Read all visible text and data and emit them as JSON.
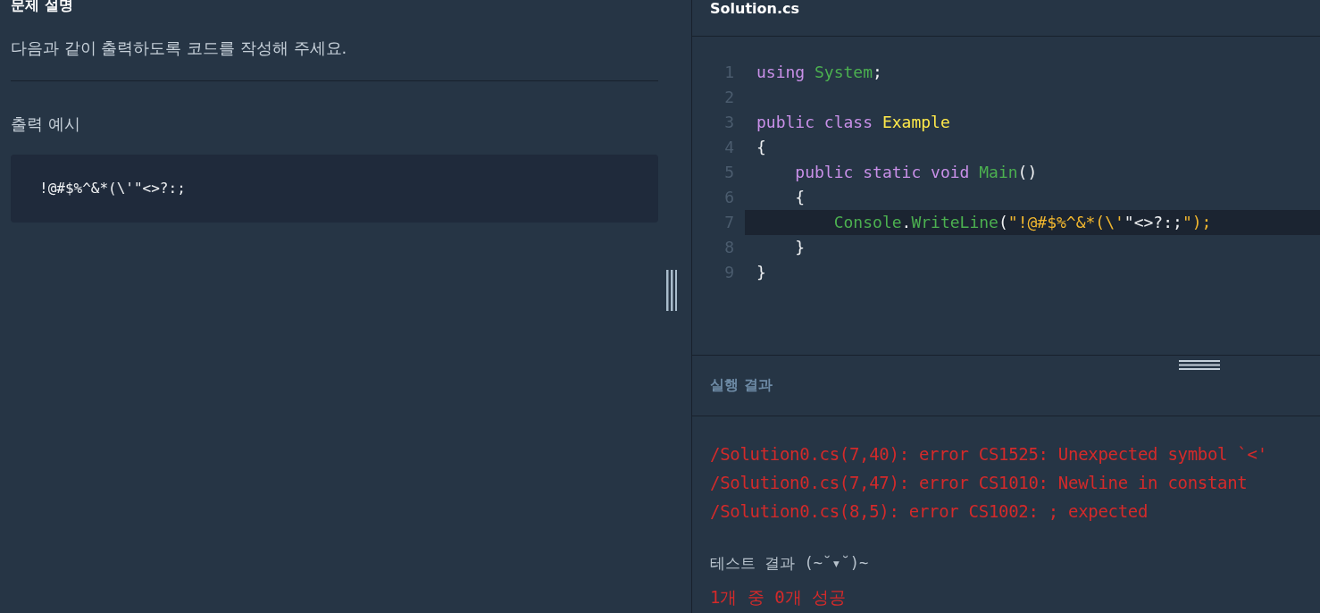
{
  "problem": {
    "title": "문제 설명",
    "description": "다음과 같이 출력하도록 코드를 작성해 주세요.",
    "example_title": "출력 예시",
    "example_output": "!@#$%^&*(\\'\"<>?:;"
  },
  "editor": {
    "filename": "Solution.cs",
    "lines": [
      {
        "number": "1",
        "highlighted": false,
        "tokens": [
          {
            "kind": "keyword",
            "text": "using"
          },
          {
            "kind": "type",
            "text": " System"
          },
          {
            "kind": "punct",
            "text": ";"
          }
        ]
      },
      {
        "number": "2",
        "highlighted": false
      },
      {
        "number": "3",
        "highlighted": false,
        "tokens": [
          {
            "kind": "keyword",
            "text": "public class"
          },
          {
            "kind": "class",
            "text": " Example"
          }
        ]
      },
      {
        "number": "4",
        "highlighted": false,
        "tokens": [
          {
            "kind": "punct",
            "text": "{"
          }
        ]
      },
      {
        "number": "5",
        "highlighted": false,
        "tokens": [
          {
            "kind": "keyword",
            "text": "    public static void"
          },
          {
            "kind": "type",
            "text": " Main"
          },
          {
            "kind": "punct",
            "text": "()"
          }
        ]
      },
      {
        "number": "6",
        "highlighted": false,
        "tokens": [
          {
            "kind": "punct",
            "text": "    {"
          }
        ]
      },
      {
        "number": "7",
        "highlighted": true,
        "tokens": [
          {
            "kind": "type",
            "text": "        Console"
          },
          {
            "kind": "punct",
            "text": "."
          },
          {
            "kind": "type",
            "text": "WriteLine"
          },
          {
            "kind": "punct",
            "text": "("
          },
          {
            "kind": "string",
            "text": "\"!@#$%^&*(\\'"
          },
          {
            "kind": "punct",
            "text": "\"<>?:;"
          },
          {
            "kind": "string",
            "text": "\");"
          }
        ]
      },
      {
        "number": "8",
        "highlighted": false,
        "tokens": [
          {
            "kind": "punct",
            "text": "    }"
          }
        ]
      },
      {
        "number": "9",
        "highlighted": false,
        "tokens": [
          {
            "kind": "punct",
            "text": "}"
          }
        ]
      }
    ]
  },
  "result": {
    "title": "실행 결과",
    "errors": [
      "/Solution0.cs(7,40): error CS1525: Unexpected symbol `<'",
      "/Solution0.cs(7,47): error CS1010: Newline in constant",
      "/Solution0.cs(8,5): error CS1002: ; expected"
    ],
    "test_title": "테스트 결과 (~˘▾˘)~",
    "test_summary": "1개 중 0개 성공"
  }
}
